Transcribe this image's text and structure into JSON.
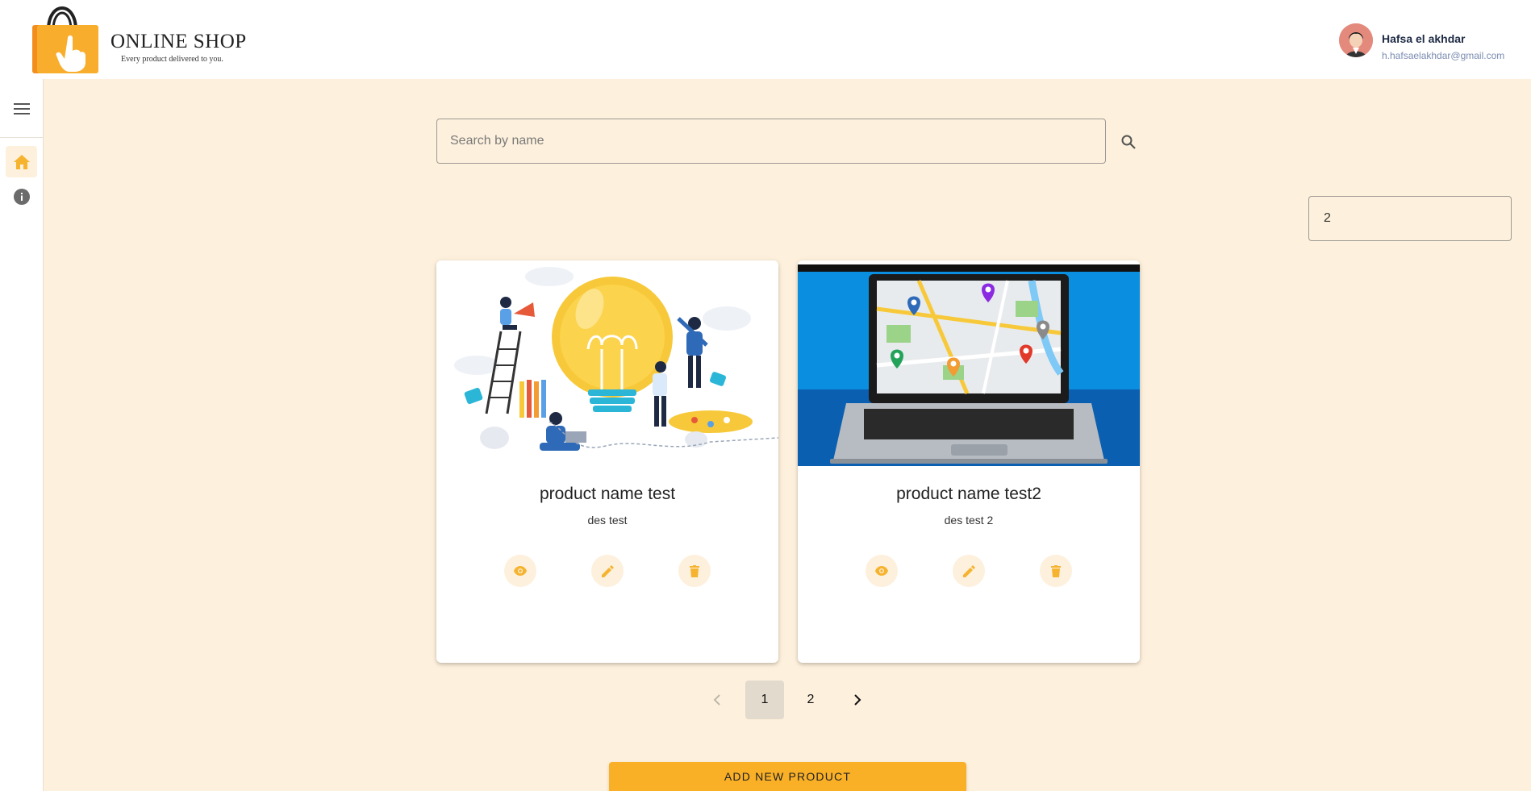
{
  "brand": {
    "name": "ONLINE SHOP",
    "tagline": "Every product delivered to you."
  },
  "user": {
    "name": "Hafsa el akhdar",
    "email": "h.hafsaelakhdar@gmail.com"
  },
  "search": {
    "placeholder": "Search by name",
    "value": ""
  },
  "page_size": {
    "value": "2"
  },
  "products": [
    {
      "title": "product name test",
      "description": "des test"
    },
    {
      "title": "product name test2",
      "description": "des test 2"
    }
  ],
  "pagination": {
    "pages": [
      "1",
      "2"
    ],
    "current": "1"
  },
  "actions": {
    "add_label": "ADD NEW PRODUCT"
  },
  "colors": {
    "accent": "#f9b027",
    "background": "#fdf0dc",
    "icon_accent": "#f6b32f"
  },
  "icons": {
    "menu": "menu-icon",
    "home": "home-icon",
    "info": "info-icon",
    "search": "search-icon",
    "view": "eye-icon",
    "edit": "pencil-icon",
    "delete": "trash-icon",
    "prev": "chevron-left-icon",
    "next": "chevron-right-icon"
  }
}
